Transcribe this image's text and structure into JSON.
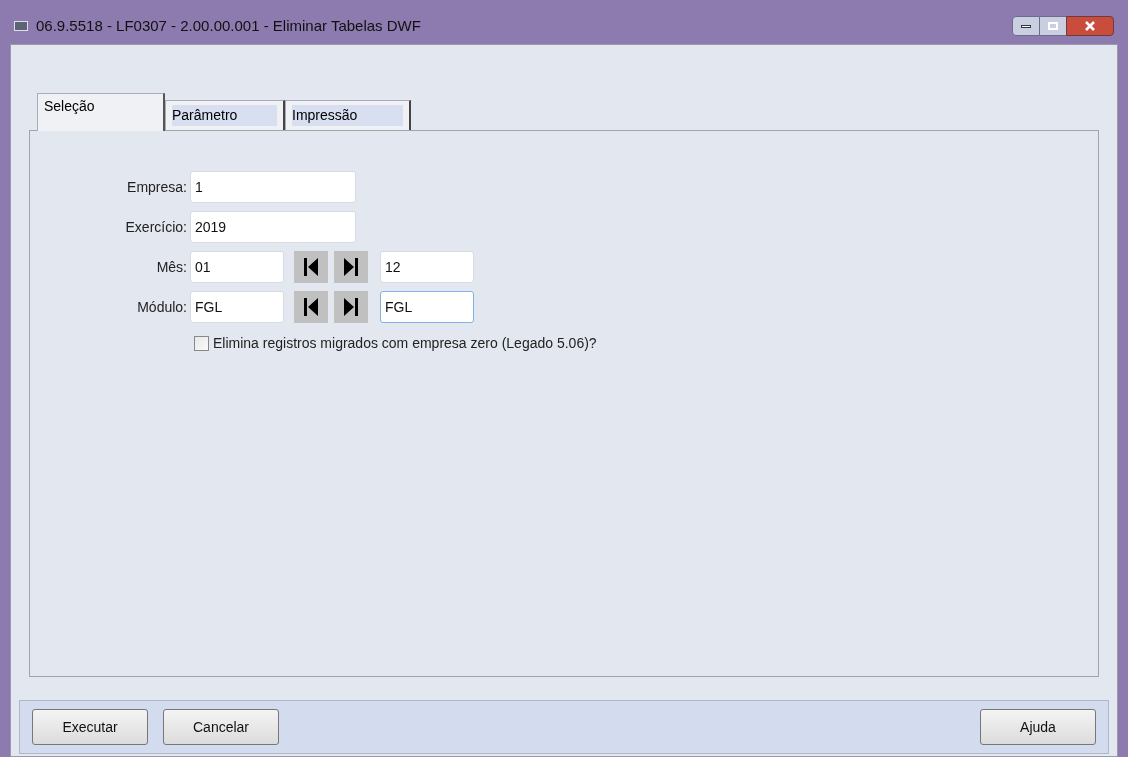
{
  "window": {
    "title": "06.9.5518 - LF0307 - 2.00.00.001 - Eliminar Tabelas DWF"
  },
  "tabs": [
    {
      "label": "Seleção",
      "selected": true
    },
    {
      "label": "Parâmetro",
      "selected": false
    },
    {
      "label": "Impressão",
      "selected": false
    }
  ],
  "fields": [
    {
      "kind": "single",
      "label": "Empresa:",
      "value": "1"
    },
    {
      "kind": "single",
      "label": "Exercício:",
      "value": "2019"
    },
    {
      "kind": "range",
      "label": "Mês:",
      "value": "01",
      "value_to": "12"
    },
    {
      "kind": "range",
      "label": "Módulo:",
      "value": "FGL",
      "value_to": "FGL"
    }
  ],
  "checkbox": {
    "label": "Elimina registros migrados com empresa zero (Legado 5.06)?",
    "checked": false
  },
  "buttons_left": [
    "Executar",
    "Cancelar"
  ],
  "buttons_right": [
    "Ajuda"
  ]
}
